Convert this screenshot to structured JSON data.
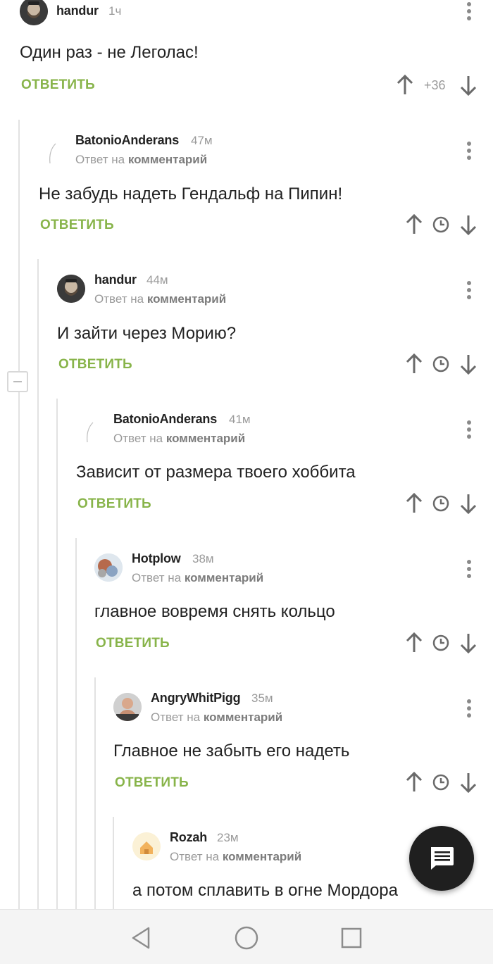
{
  "reply_prefix": "Ответ на",
  "reply_link": "комментарий",
  "reply_label": "ОТВЕТИТЬ",
  "colors": {
    "accent": "#88b44a",
    "muted": "#9a9a9a",
    "text": "#222222",
    "fab": "#1f1f1f"
  },
  "comments": [
    {
      "author": "handur",
      "time": "1ч",
      "text": "Один раз - не Леголас!",
      "score": "+36",
      "is_reply": false,
      "avatar": "bearded-man"
    },
    {
      "author": "BatonioAnderans",
      "time": "47м",
      "text": "Не забудь надеть Гендальф на Пипин!",
      "is_reply": true,
      "avatar": "feather"
    },
    {
      "author": "handur",
      "time": "44м",
      "text": "И зайти через Морию?",
      "is_reply": true,
      "avatar": "bearded-man"
    },
    {
      "author": "BatonioAnderans",
      "time": "41м",
      "text": "Зависит от размера твоего хоббита",
      "is_reply": true,
      "avatar": "feather"
    },
    {
      "author": "Hotplow",
      "time": "38м",
      "text": "главное вовремя снять кольцо",
      "is_reply": true,
      "avatar": "cat"
    },
    {
      "author": "AngryWhitPigg",
      "time": "35м",
      "text": "Главное не забыть его надеть",
      "is_reply": true,
      "avatar": "man"
    },
    {
      "author": "Rozah",
      "time": "23м",
      "text": "а потом сплавить в огне Мордора",
      "is_reply": true,
      "avatar": "house"
    }
  ],
  "icons": {
    "upvote": "arrow-up-icon",
    "downvote": "arrow-down-icon",
    "later": "clock-icon",
    "more": "kebab-menu-icon",
    "collapse": "minus-icon",
    "fab": "comment-icon",
    "nav": [
      "back-triangle-icon",
      "home-circle-icon",
      "recents-square-icon"
    ]
  }
}
